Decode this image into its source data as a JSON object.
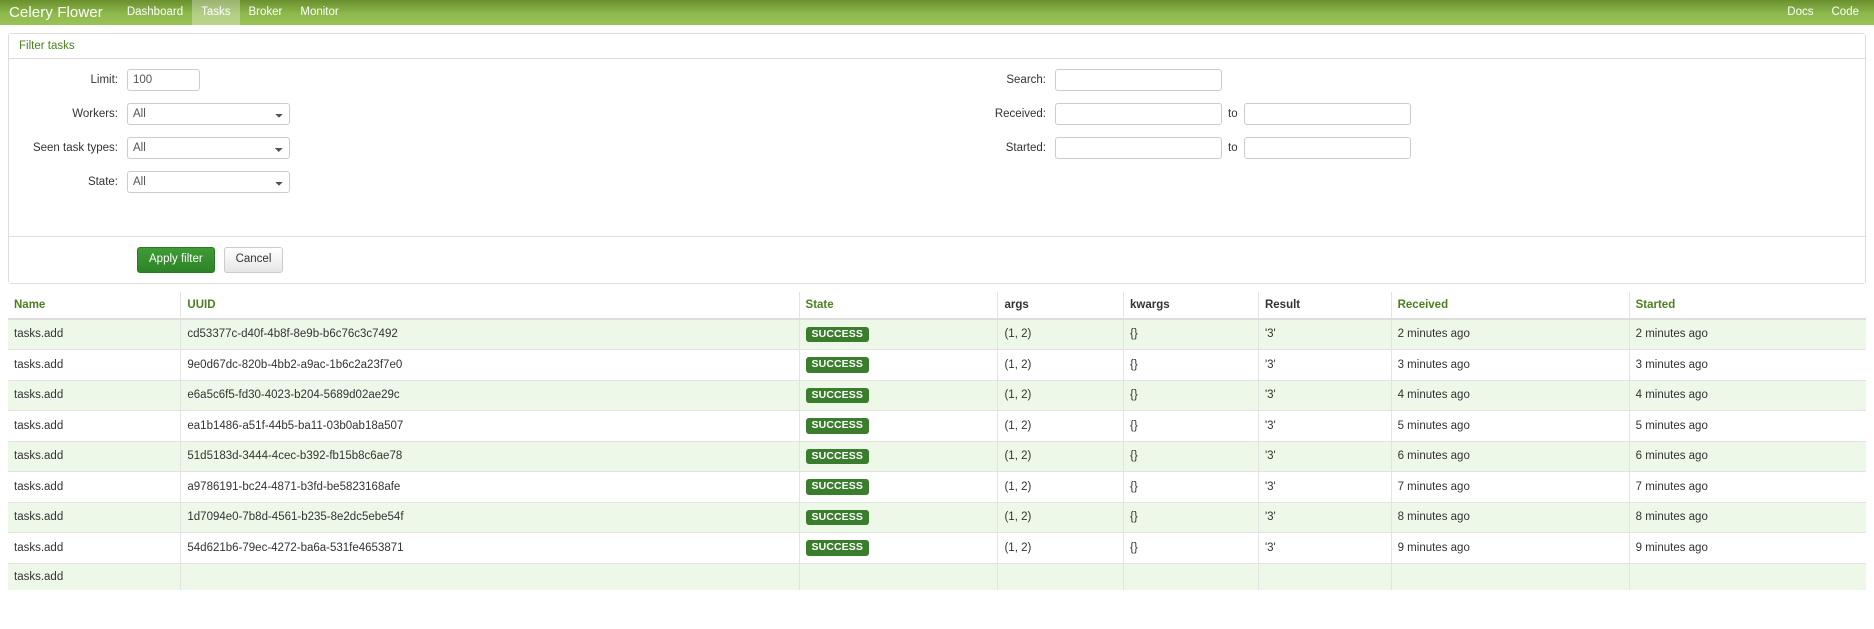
{
  "navbar": {
    "brand": "Celery Flower",
    "left_items": [
      {
        "label": "Dashboard",
        "active": false
      },
      {
        "label": "Tasks",
        "active": true
      },
      {
        "label": "Broker",
        "active": false
      },
      {
        "label": "Monitor",
        "active": false
      }
    ],
    "right_items": [
      {
        "label": "Docs"
      },
      {
        "label": "Code"
      }
    ]
  },
  "filter_panel": {
    "title": "Filter tasks",
    "fields": {
      "limit_label": "Limit:",
      "limit_value": "100",
      "workers_label": "Workers:",
      "workers_value": "All",
      "seen_task_types_label": "Seen task types:",
      "seen_task_types_value": "All",
      "state_label": "State:",
      "state_value": "All",
      "search_label": "Search:",
      "search_value": "",
      "received_label": "Received:",
      "received_from_value": "",
      "received_to_value": "",
      "started_label": "Started:",
      "started_from_value": "",
      "started_to_value": "",
      "to_separator": "to"
    },
    "select_options": {
      "workers": [
        "All"
      ],
      "seen_task_types": [
        "All"
      ],
      "state": [
        "All"
      ]
    },
    "apply_button": "Apply filter",
    "cancel_button": "Cancel"
  },
  "table": {
    "columns": [
      {
        "key": "name",
        "label": "Name",
        "sortable": true
      },
      {
        "key": "uuid",
        "label": "UUID",
        "sortable": true
      },
      {
        "key": "state",
        "label": "State",
        "sortable": true
      },
      {
        "key": "args",
        "label": "args",
        "sortable": false
      },
      {
        "key": "kwargs",
        "label": "kwargs",
        "sortable": false
      },
      {
        "key": "result",
        "label": "Result",
        "sortable": false
      },
      {
        "key": "received",
        "label": "Received",
        "sortable": true
      },
      {
        "key": "started",
        "label": "Started",
        "sortable": true
      }
    ],
    "rows": [
      {
        "name": "tasks.add",
        "uuid": "cd53377c-d40f-4b8f-8e9b-b6c76c3c7492",
        "state": "SUCCESS",
        "args": "(1, 2)",
        "kwargs": "{}",
        "result": "'3'",
        "received": "2 minutes ago",
        "started": "2 minutes ago"
      },
      {
        "name": "tasks.add",
        "uuid": "9e0d67dc-820b-4bb2-a9ac-1b6c2a23f7e0",
        "state": "SUCCESS",
        "args": "(1, 2)",
        "kwargs": "{}",
        "result": "'3'",
        "received": "3 minutes ago",
        "started": "3 minutes ago"
      },
      {
        "name": "tasks.add",
        "uuid": "e6a5c6f5-fd30-4023-b204-5689d02ae29c",
        "state": "SUCCESS",
        "args": "(1, 2)",
        "kwargs": "{}",
        "result": "'3'",
        "received": "4 minutes ago",
        "started": "4 minutes ago"
      },
      {
        "name": "tasks.add",
        "uuid": "ea1b1486-a51f-44b5-ba11-03b0ab18a507",
        "state": "SUCCESS",
        "args": "(1, 2)",
        "kwargs": "{}",
        "result": "'3'",
        "received": "5 minutes ago",
        "started": "5 minutes ago"
      },
      {
        "name": "tasks.add",
        "uuid": "51d5183d-3444-4cec-b392-fb15b8c6ae78",
        "state": "SUCCESS",
        "args": "(1, 2)",
        "kwargs": "{}",
        "result": "'3'",
        "received": "6 minutes ago",
        "started": "6 minutes ago"
      },
      {
        "name": "tasks.add",
        "uuid": "a9786191-bc24-4871-b3fd-be5823168afe",
        "state": "SUCCESS",
        "args": "(1, 2)",
        "kwargs": "{}",
        "result": "'3'",
        "received": "7 minutes ago",
        "started": "7 minutes ago"
      },
      {
        "name": "tasks.add",
        "uuid": "1d7094e0-7b8d-4561-b235-8e2dc5ebe54f",
        "state": "SUCCESS",
        "args": "(1, 2)",
        "kwargs": "{}",
        "result": "'3'",
        "received": "8 minutes ago",
        "started": "8 minutes ago"
      },
      {
        "name": "tasks.add",
        "uuid": "54d621b6-79ec-4272-ba6a-531fe4653871",
        "state": "SUCCESS",
        "args": "(1, 2)",
        "kwargs": "{}",
        "result": "'3'",
        "received": "9 minutes ago",
        "started": "9 minutes ago"
      },
      {
        "name": "tasks.add",
        "uuid": "",
        "state": "",
        "args": "",
        "kwargs": "",
        "result": "",
        "received": "",
        "started": ""
      }
    ]
  },
  "colors": {
    "navbar_gradient_start": "#6b8f2e",
    "navbar_gradient_end": "#9ac356",
    "accent_green": "#4b7f1f",
    "success_badge": "#3a7d2c",
    "primary_button": "#2d8428",
    "row_alt": "#eef8e8"
  }
}
